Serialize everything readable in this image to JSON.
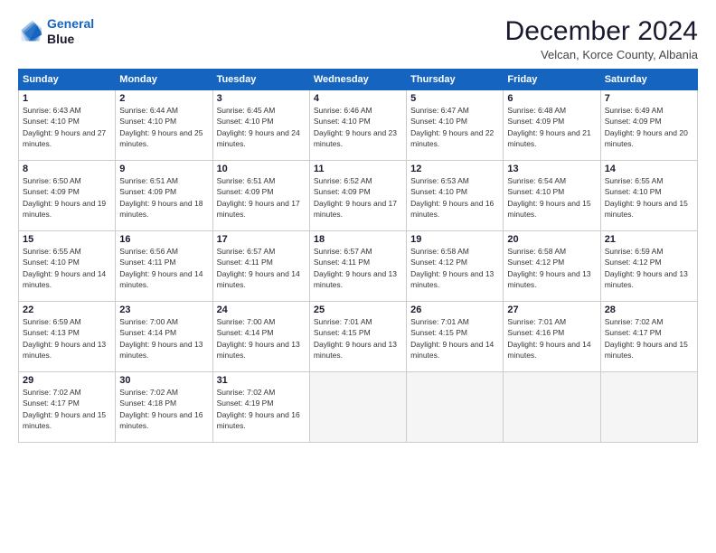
{
  "logo": {
    "line1": "General",
    "line2": "Blue"
  },
  "title": "December 2024",
  "subtitle": "Velcan, Korce County, Albania",
  "weekdays": [
    "Sunday",
    "Monday",
    "Tuesday",
    "Wednesday",
    "Thursday",
    "Friday",
    "Saturday"
  ],
  "weeks": [
    [
      {
        "day": "1",
        "sunrise": "Sunrise: 6:43 AM",
        "sunset": "Sunset: 4:10 PM",
        "daylight": "Daylight: 9 hours and 27 minutes."
      },
      {
        "day": "2",
        "sunrise": "Sunrise: 6:44 AM",
        "sunset": "Sunset: 4:10 PM",
        "daylight": "Daylight: 9 hours and 25 minutes."
      },
      {
        "day": "3",
        "sunrise": "Sunrise: 6:45 AM",
        "sunset": "Sunset: 4:10 PM",
        "daylight": "Daylight: 9 hours and 24 minutes."
      },
      {
        "day": "4",
        "sunrise": "Sunrise: 6:46 AM",
        "sunset": "Sunset: 4:10 PM",
        "daylight": "Daylight: 9 hours and 23 minutes."
      },
      {
        "day": "5",
        "sunrise": "Sunrise: 6:47 AM",
        "sunset": "Sunset: 4:10 PM",
        "daylight": "Daylight: 9 hours and 22 minutes."
      },
      {
        "day": "6",
        "sunrise": "Sunrise: 6:48 AM",
        "sunset": "Sunset: 4:09 PM",
        "daylight": "Daylight: 9 hours and 21 minutes."
      },
      {
        "day": "7",
        "sunrise": "Sunrise: 6:49 AM",
        "sunset": "Sunset: 4:09 PM",
        "daylight": "Daylight: 9 hours and 20 minutes."
      }
    ],
    [
      {
        "day": "8",
        "sunrise": "Sunrise: 6:50 AM",
        "sunset": "Sunset: 4:09 PM",
        "daylight": "Daylight: 9 hours and 19 minutes."
      },
      {
        "day": "9",
        "sunrise": "Sunrise: 6:51 AM",
        "sunset": "Sunset: 4:09 PM",
        "daylight": "Daylight: 9 hours and 18 minutes."
      },
      {
        "day": "10",
        "sunrise": "Sunrise: 6:51 AM",
        "sunset": "Sunset: 4:09 PM",
        "daylight": "Daylight: 9 hours and 17 minutes."
      },
      {
        "day": "11",
        "sunrise": "Sunrise: 6:52 AM",
        "sunset": "Sunset: 4:09 PM",
        "daylight": "Daylight: 9 hours and 17 minutes."
      },
      {
        "day": "12",
        "sunrise": "Sunrise: 6:53 AM",
        "sunset": "Sunset: 4:10 PM",
        "daylight": "Daylight: 9 hours and 16 minutes."
      },
      {
        "day": "13",
        "sunrise": "Sunrise: 6:54 AM",
        "sunset": "Sunset: 4:10 PM",
        "daylight": "Daylight: 9 hours and 15 minutes."
      },
      {
        "day": "14",
        "sunrise": "Sunrise: 6:55 AM",
        "sunset": "Sunset: 4:10 PM",
        "daylight": "Daylight: 9 hours and 15 minutes."
      }
    ],
    [
      {
        "day": "15",
        "sunrise": "Sunrise: 6:55 AM",
        "sunset": "Sunset: 4:10 PM",
        "daylight": "Daylight: 9 hours and 14 minutes."
      },
      {
        "day": "16",
        "sunrise": "Sunrise: 6:56 AM",
        "sunset": "Sunset: 4:11 PM",
        "daylight": "Daylight: 9 hours and 14 minutes."
      },
      {
        "day": "17",
        "sunrise": "Sunrise: 6:57 AM",
        "sunset": "Sunset: 4:11 PM",
        "daylight": "Daylight: 9 hours and 14 minutes."
      },
      {
        "day": "18",
        "sunrise": "Sunrise: 6:57 AM",
        "sunset": "Sunset: 4:11 PM",
        "daylight": "Daylight: 9 hours and 13 minutes."
      },
      {
        "day": "19",
        "sunrise": "Sunrise: 6:58 AM",
        "sunset": "Sunset: 4:12 PM",
        "daylight": "Daylight: 9 hours and 13 minutes."
      },
      {
        "day": "20",
        "sunrise": "Sunrise: 6:58 AM",
        "sunset": "Sunset: 4:12 PM",
        "daylight": "Daylight: 9 hours and 13 minutes."
      },
      {
        "day": "21",
        "sunrise": "Sunrise: 6:59 AM",
        "sunset": "Sunset: 4:12 PM",
        "daylight": "Daylight: 9 hours and 13 minutes."
      }
    ],
    [
      {
        "day": "22",
        "sunrise": "Sunrise: 6:59 AM",
        "sunset": "Sunset: 4:13 PM",
        "daylight": "Daylight: 9 hours and 13 minutes."
      },
      {
        "day": "23",
        "sunrise": "Sunrise: 7:00 AM",
        "sunset": "Sunset: 4:14 PM",
        "daylight": "Daylight: 9 hours and 13 minutes."
      },
      {
        "day": "24",
        "sunrise": "Sunrise: 7:00 AM",
        "sunset": "Sunset: 4:14 PM",
        "daylight": "Daylight: 9 hours and 13 minutes."
      },
      {
        "day": "25",
        "sunrise": "Sunrise: 7:01 AM",
        "sunset": "Sunset: 4:15 PM",
        "daylight": "Daylight: 9 hours and 13 minutes."
      },
      {
        "day": "26",
        "sunrise": "Sunrise: 7:01 AM",
        "sunset": "Sunset: 4:15 PM",
        "daylight": "Daylight: 9 hours and 14 minutes."
      },
      {
        "day": "27",
        "sunrise": "Sunrise: 7:01 AM",
        "sunset": "Sunset: 4:16 PM",
        "daylight": "Daylight: 9 hours and 14 minutes."
      },
      {
        "day": "28",
        "sunrise": "Sunrise: 7:02 AM",
        "sunset": "Sunset: 4:17 PM",
        "daylight": "Daylight: 9 hours and 15 minutes."
      }
    ],
    [
      {
        "day": "29",
        "sunrise": "Sunrise: 7:02 AM",
        "sunset": "Sunset: 4:17 PM",
        "daylight": "Daylight: 9 hours and 15 minutes."
      },
      {
        "day": "30",
        "sunrise": "Sunrise: 7:02 AM",
        "sunset": "Sunset: 4:18 PM",
        "daylight": "Daylight: 9 hours and 16 minutes."
      },
      {
        "day": "31",
        "sunrise": "Sunrise: 7:02 AM",
        "sunset": "Sunset: 4:19 PM",
        "daylight": "Daylight: 9 hours and 16 minutes."
      },
      null,
      null,
      null,
      null
    ]
  ]
}
